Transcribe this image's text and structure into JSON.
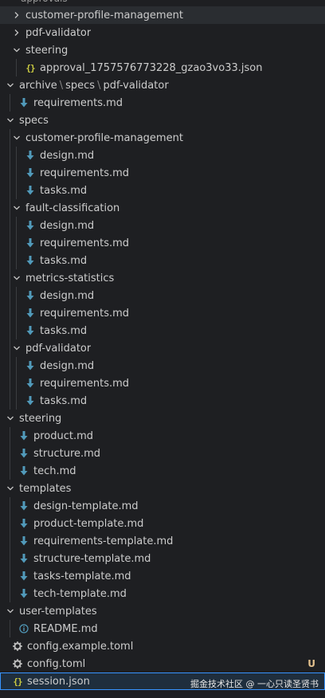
{
  "explorer": {
    "top_cut_label": "approvals",
    "watermark": "掘金技术社区 @ 一心只读圣贤书",
    "items": [
      {
        "label": "customer-profile-management",
        "level": 1,
        "kind": "folder",
        "expanded": false,
        "state": "hover"
      },
      {
        "label": "pdf-validator",
        "level": 1,
        "kind": "folder",
        "expanded": false
      },
      {
        "label": "steering",
        "level": 1,
        "kind": "folder",
        "expanded": true
      },
      {
        "label": "approval_1757576773228_gzao3vo33.json",
        "level": 2,
        "kind": "json"
      },
      {
        "label": "archive",
        "path": [
          "archive",
          "specs",
          "pdf-validator"
        ],
        "level": 0,
        "kind": "folder",
        "expanded": true
      },
      {
        "label": "requirements.md",
        "level": 1,
        "kind": "md"
      },
      {
        "label": "specs",
        "level": 0,
        "kind": "folder",
        "expanded": true
      },
      {
        "label": "customer-profile-management",
        "level": 1,
        "kind": "folder",
        "expanded": true
      },
      {
        "label": "design.md",
        "level": 2,
        "kind": "md"
      },
      {
        "label": "requirements.md",
        "level": 2,
        "kind": "md"
      },
      {
        "label": "tasks.md",
        "level": 2,
        "kind": "md"
      },
      {
        "label": "fault-classification",
        "level": 1,
        "kind": "folder",
        "expanded": true
      },
      {
        "label": "design.md",
        "level": 2,
        "kind": "md"
      },
      {
        "label": "requirements.md",
        "level": 2,
        "kind": "md"
      },
      {
        "label": "tasks.md",
        "level": 2,
        "kind": "md"
      },
      {
        "label": "metrics-statistics",
        "level": 1,
        "kind": "folder",
        "expanded": true
      },
      {
        "label": "design.md",
        "level": 2,
        "kind": "md"
      },
      {
        "label": "requirements.md",
        "level": 2,
        "kind": "md"
      },
      {
        "label": "tasks.md",
        "level": 2,
        "kind": "md"
      },
      {
        "label": "pdf-validator",
        "level": 1,
        "kind": "folder",
        "expanded": true
      },
      {
        "label": "design.md",
        "level": 2,
        "kind": "md"
      },
      {
        "label": "requirements.md",
        "level": 2,
        "kind": "md"
      },
      {
        "label": "tasks.md",
        "level": 2,
        "kind": "md"
      },
      {
        "label": "steering",
        "level": 0,
        "kind": "folder",
        "expanded": true
      },
      {
        "label": "product.md",
        "level": 1,
        "kind": "md"
      },
      {
        "label": "structure.md",
        "level": 1,
        "kind": "md"
      },
      {
        "label": "tech.md",
        "level": 1,
        "kind": "md"
      },
      {
        "label": "templates",
        "level": 0,
        "kind": "folder",
        "expanded": true
      },
      {
        "label": "design-template.md",
        "level": 1,
        "kind": "md"
      },
      {
        "label": "product-template.md",
        "level": 1,
        "kind": "md"
      },
      {
        "label": "requirements-template.md",
        "level": 1,
        "kind": "md"
      },
      {
        "label": "structure-template.md",
        "level": 1,
        "kind": "md"
      },
      {
        "label": "tasks-template.md",
        "level": 1,
        "kind": "md"
      },
      {
        "label": "tech-template.md",
        "level": 1,
        "kind": "md"
      },
      {
        "label": "user-templates",
        "level": 0,
        "kind": "folder",
        "expanded": true
      },
      {
        "label": "README.md",
        "level": 1,
        "kind": "info"
      },
      {
        "label": "config.example.toml",
        "level": 0,
        "kind": "gear"
      },
      {
        "label": "config.toml",
        "level": 0,
        "kind": "gear",
        "badge": "U"
      },
      {
        "label": "session.json",
        "level": 0,
        "kind": "json",
        "state": "selected"
      }
    ]
  },
  "colors": {
    "background": "#1e1f22",
    "text": "#cccccc",
    "md_icon": "#519aba",
    "json_icon": "#cbcb41",
    "gear_icon": "#bcbcbc",
    "info_icon": "#519aba",
    "badge": "#e2c08d",
    "selected_bg": "#1f2e3d",
    "selected_border": "#3794ff",
    "hover_bg": "#2a2d31"
  }
}
